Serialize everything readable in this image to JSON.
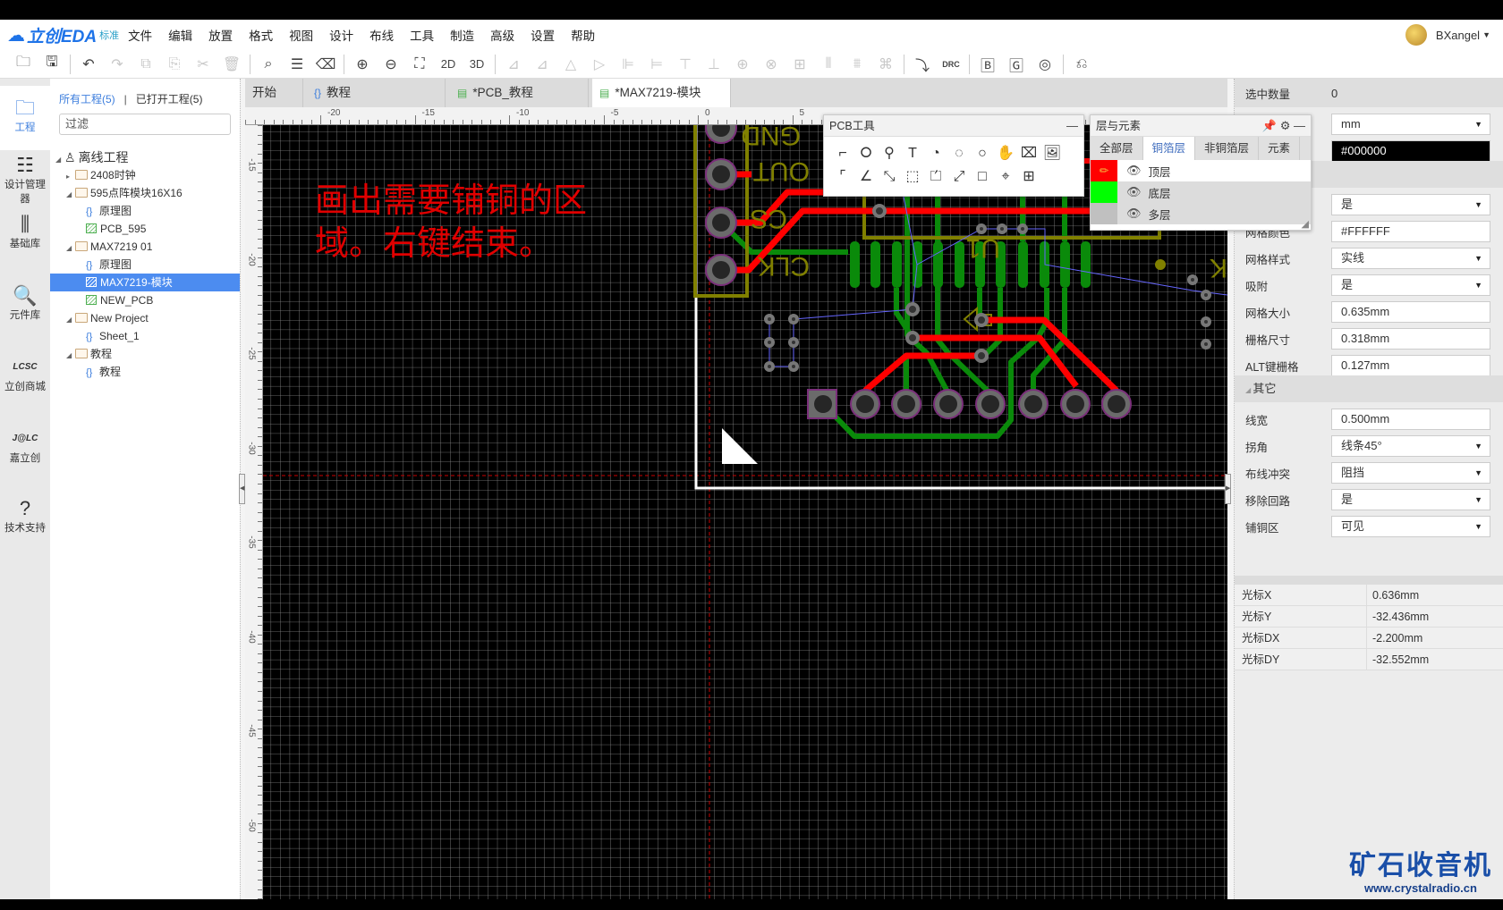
{
  "app": {
    "logo": "立创EDA",
    "edition": "标准",
    "user": "BXangel"
  },
  "menu": [
    "文件",
    "编辑",
    "放置",
    "格式",
    "视图",
    "设计",
    "布线",
    "工具",
    "制造",
    "高级",
    "设置",
    "帮助"
  ],
  "toolbar": [
    {
      "icon": "open-icon",
      "g": "🗀"
    },
    {
      "icon": "save-icon",
      "g": "🖫"
    },
    {
      "sep": true
    },
    {
      "icon": "undo-icon",
      "g": "↶"
    },
    {
      "icon": "redo-icon",
      "g": "↷",
      "dis": true
    },
    {
      "icon": "copy-icon",
      "g": "⧉",
      "dis": true
    },
    {
      "icon": "paste-icon",
      "g": "⎘",
      "dis": true
    },
    {
      "icon": "cut-icon",
      "g": "✂",
      "dis": true
    },
    {
      "icon": "delete-icon",
      "g": "🗑",
      "dis": true
    },
    {
      "sep": true
    },
    {
      "icon": "search-icon",
      "g": "⌕"
    },
    {
      "icon": "find-list-icon",
      "g": "☰"
    },
    {
      "icon": "eraser-icon",
      "g": "⌫"
    },
    {
      "sep": true
    },
    {
      "icon": "zoom-in-icon",
      "g": "⊕"
    },
    {
      "icon": "zoom-out-icon",
      "g": "⊖"
    },
    {
      "icon": "fit-icon",
      "g": "⛶"
    },
    {
      "icon": "view-2d-icon",
      "g": "2D",
      "txt": true
    },
    {
      "icon": "view-3d-icon",
      "g": "3D",
      "txt": true
    },
    {
      "sep": true
    },
    {
      "icon": "align-left-icon",
      "g": "⊿",
      "dis": true
    },
    {
      "icon": "align-right-icon",
      "g": "⊿",
      "dis": true
    },
    {
      "icon": "align-top-icon",
      "g": "△",
      "dis": true
    },
    {
      "icon": "align-bottom-icon",
      "g": "▷",
      "dis": true
    },
    {
      "icon": "align-h-icon",
      "g": "⊫",
      "dis": true
    },
    {
      "icon": "align-v-icon",
      "g": "⊨",
      "dis": true
    },
    {
      "icon": "align-t2-icon",
      "g": "⊤",
      "dis": true
    },
    {
      "icon": "align-b2-icon",
      "g": "⊥",
      "dis": true
    },
    {
      "icon": "center-h-icon",
      "g": "⊕",
      "dis": true
    },
    {
      "icon": "center-v-icon",
      "g": "⊗",
      "dis": true
    },
    {
      "icon": "grid-icon",
      "g": "⊞",
      "dis": true
    },
    {
      "icon": "distribute-h-icon",
      "g": "⫴",
      "dis": true
    },
    {
      "icon": "distribute-v-icon",
      "g": "⩩",
      "dis": true
    },
    {
      "icon": "group-icon",
      "g": "⌘",
      "dis": true
    },
    {
      "sep": true
    },
    {
      "icon": "import-changes-icon",
      "g": "⤵"
    },
    {
      "icon": "drc-icon",
      "g": "DRC",
      "small": true
    },
    {
      "sep": true
    },
    {
      "icon": "export-bom-icon",
      "g": "🄱"
    },
    {
      "icon": "gerber-icon",
      "g": "🄶"
    },
    {
      "icon": "pick-place-icon",
      "g": "◎"
    },
    {
      "sep": true
    },
    {
      "icon": "back-icon",
      "g": "⎌"
    }
  ],
  "leftbar": [
    {
      "label": "工程",
      "icon": "project-icon",
      "g": "🗀",
      "active": true
    },
    {
      "label": "设计管理器",
      "icon": "design-manager-icon",
      "g": "☷"
    },
    {
      "label": "基础库",
      "icon": "basic-library-icon",
      "g": "⫼"
    },
    {
      "label": "元件库",
      "icon": "component-library-icon",
      "g": "🔍"
    },
    {
      "label": "立创商城",
      "icon": "lcsc-icon",
      "g": "LCSC"
    },
    {
      "label": "嘉立创",
      "icon": "jlc-icon",
      "g": "J@LC"
    },
    {
      "label": "技术支持",
      "icon": "help-icon",
      "g": "?"
    }
  ],
  "tree": {
    "tab_all": "所有工程(5)",
    "divider": "|",
    "tab_open": "已打开工程(5)",
    "filter_placeholder": "过滤",
    "rows": [
      {
        "label": "离线工程",
        "type": "root",
        "level": 0,
        "arrow": "◢"
      },
      {
        "label": "2408时钟",
        "type": "folder",
        "level": 1,
        "arrow": "▸"
      },
      {
        "label": "595点阵模块16X16",
        "type": "folder",
        "level": 1,
        "arrow": "◢"
      },
      {
        "label": "原理图",
        "type": "sch",
        "level": 2
      },
      {
        "label": "PCB_595",
        "type": "pcb",
        "level": 2
      },
      {
        "label": "MAX7219 01",
        "type": "folder",
        "level": 1,
        "arrow": "◢"
      },
      {
        "label": "原理图",
        "type": "sch",
        "level": 2
      },
      {
        "label": "MAX7219-模块",
        "type": "pcb",
        "level": 2,
        "selected": true
      },
      {
        "label": "NEW_PCB",
        "type": "pcb",
        "level": 2
      },
      {
        "label": "New Project",
        "type": "folder",
        "level": 1,
        "arrow": "◢"
      },
      {
        "label": "Sheet_1",
        "type": "sch",
        "level": 2
      },
      {
        "label": "教程",
        "type": "folder",
        "level": 1,
        "arrow": "◢"
      },
      {
        "label": "教程",
        "type": "sch",
        "level": 2
      }
    ]
  },
  "tabs": [
    {
      "label": "开始",
      "type": "home"
    },
    {
      "label": "教程",
      "type": "sch"
    },
    {
      "label": "*PCB_教程",
      "type": "pcb"
    },
    {
      "label": "*MAX7219-模块",
      "type": "pcb",
      "active": true
    }
  ],
  "ruler": {
    "h": [
      -20,
      -15,
      -10,
      -5,
      0,
      5
    ],
    "v": [
      -15,
      -20,
      -25,
      -30,
      -35,
      -40,
      -45,
      -50
    ]
  },
  "canvas": {
    "annotation_line1": "画出需要铺铜的区",
    "annotation_line2": "域。右键结束。",
    "silk": {
      "gnd": "GND",
      "out": "OUT",
      "cs": "CS",
      "clk": "CLK",
      "u1": "U1",
      "k": "K"
    },
    "colors": {
      "top": "#ff0000",
      "bottom": "#008000",
      "silk": "#808000",
      "ratsnest": "#6666ff",
      "outline": "#ffffff"
    }
  },
  "pcb_tools": {
    "title": "PCB工具",
    "minimize": "—",
    "tools": [
      {
        "icon": "track-icon",
        "g": "⌐"
      },
      {
        "icon": "pad-icon",
        "g": "⭘"
      },
      {
        "icon": "via-icon",
        "g": "⚲"
      },
      {
        "icon": "text-icon",
        "g": "T"
      },
      {
        "icon": "arc-center-icon",
        "g": "◔"
      },
      {
        "icon": "arc-icon",
        "g": "◌"
      },
      {
        "icon": "circle-icon",
        "g": "○"
      },
      {
        "icon": "pan-hand-icon",
        "g": "✋"
      },
      {
        "icon": "hole-icon",
        "g": "⌧"
      },
      {
        "icon": "image-icon",
        "g": "🖼"
      },
      {
        "icon": "dimension-icon",
        "g": "⌜"
      },
      {
        "icon": "protractor-icon",
        "g": "∠"
      },
      {
        "icon": "connect-pad-icon",
        "g": "⤡"
      },
      {
        "icon": "copper-area-icon",
        "g": "⬚"
      },
      {
        "icon": "solid-region-icon",
        "g": "⏍"
      },
      {
        "icon": "measure-icon",
        "g": "⤢"
      },
      {
        "icon": "rect-icon",
        "g": "□"
      },
      {
        "icon": "canvas-origin-icon",
        "g": "⌖"
      },
      {
        "icon": "table-icon",
        "g": "⊞"
      }
    ]
  },
  "layers": {
    "title": "层与元素",
    "tabs": [
      "全部层",
      "铜箔层",
      "非铜箔层",
      "元素"
    ],
    "active_tab": 1,
    "rows": [
      {
        "label": "顶层",
        "color": "#ff0000",
        "active": true
      },
      {
        "label": "底层",
        "color": "#00ff00"
      },
      {
        "label": "多层",
        "color": "#c0c0c0"
      }
    ]
  },
  "props": {
    "selected_count_label": "选中数量",
    "selected_count": "0",
    "rows": [
      {
        "label": "",
        "value": "mm",
        "select": true
      },
      {
        "label": "",
        "value": "#000000",
        "black": true
      },
      {
        "section": ""
      },
      {
        "label": "",
        "value": "是",
        "select": true
      },
      {
        "label": "网格颜色",
        "value": "#FFFFFF"
      },
      {
        "label": "网格样式",
        "value": "实线",
        "select": true
      },
      {
        "label": "吸附",
        "value": "是",
        "select": true
      },
      {
        "label": "网格大小",
        "value": "0.635mm"
      },
      {
        "label": "栅格尺寸",
        "value": "0.318mm"
      },
      {
        "label": "ALT键栅格",
        "value": "0.127mm"
      },
      {
        "section": "其它"
      },
      {
        "label": "线宽",
        "value": "0.500mm"
      },
      {
        "label": "拐角",
        "value": "线条45°",
        "select": true
      },
      {
        "label": "布线冲突",
        "value": "阻挡",
        "select": true
      },
      {
        "label": "移除回路",
        "value": "是",
        "select": true
      },
      {
        "label": "铺铜区",
        "value": "可见",
        "select": true
      }
    ],
    "cursor": [
      {
        "label": "光标X",
        "value": "0.636mm"
      },
      {
        "label": "光标Y",
        "value": "-32.436mm"
      },
      {
        "label": "光标DX",
        "value": "-2.200mm"
      },
      {
        "label": "光标DY",
        "value": "-32.552mm"
      }
    ]
  },
  "watermark": {
    "title": "矿石收音机",
    "url": "www.crystalradio.cn"
  }
}
